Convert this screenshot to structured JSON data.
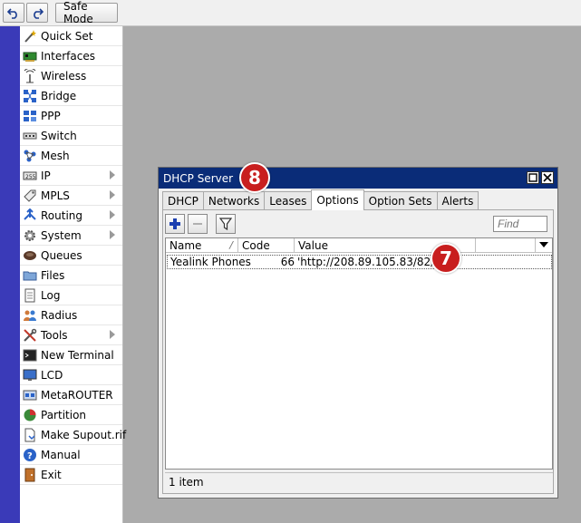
{
  "toolbar": {
    "undo_icon": "undo-icon",
    "redo_icon": "redo-icon",
    "safe_mode_label": "Safe Mode"
  },
  "menu": {
    "items": [
      {
        "label": "Quick Set",
        "icon": "wand-icon",
        "submenu": false
      },
      {
        "label": "Interfaces",
        "icon": "interface-card-icon",
        "submenu": false
      },
      {
        "label": "Wireless",
        "icon": "antenna-icon",
        "submenu": false
      },
      {
        "label": "Bridge",
        "icon": "bridge-icon",
        "submenu": false
      },
      {
        "label": "PPP",
        "icon": "ppp-icon",
        "submenu": false
      },
      {
        "label": "Switch",
        "icon": "switch-icon",
        "submenu": false
      },
      {
        "label": "Mesh",
        "icon": "mesh-icon",
        "submenu": false
      },
      {
        "label": "IP",
        "icon": "ip-icon",
        "submenu": true
      },
      {
        "label": "MPLS",
        "icon": "mpls-icon",
        "submenu": true
      },
      {
        "label": "Routing",
        "icon": "routing-icon",
        "submenu": true
      },
      {
        "label": "System",
        "icon": "gear-icon",
        "submenu": true
      },
      {
        "label": "Queues",
        "icon": "queues-icon",
        "submenu": false
      },
      {
        "label": "Files",
        "icon": "folder-icon",
        "submenu": false
      },
      {
        "label": "Log",
        "icon": "log-icon",
        "submenu": false
      },
      {
        "label": "Radius",
        "icon": "users-icon",
        "submenu": false
      },
      {
        "label": "Tools",
        "icon": "tools-icon",
        "submenu": true
      },
      {
        "label": "New Terminal",
        "icon": "terminal-icon",
        "submenu": false
      },
      {
        "label": "LCD",
        "icon": "monitor-icon",
        "submenu": false
      },
      {
        "label": "MetaROUTER",
        "icon": "metarouter-icon",
        "submenu": false
      },
      {
        "label": "Partition",
        "icon": "pie-icon",
        "submenu": false
      },
      {
        "label": "Make Supout.rif",
        "icon": "document-icon",
        "submenu": false
      },
      {
        "label": "Manual",
        "icon": "help-icon",
        "submenu": false
      },
      {
        "label": "Exit",
        "icon": "exit-door-icon",
        "submenu": false
      }
    ]
  },
  "window": {
    "title": "DHCP Server",
    "tabs": [
      {
        "label": "DHCP",
        "active": false
      },
      {
        "label": "Networks",
        "active": false
      },
      {
        "label": "Leases",
        "active": false
      },
      {
        "label": "Options",
        "active": true
      },
      {
        "label": "Option Sets",
        "active": false
      },
      {
        "label": "Alerts",
        "active": false
      }
    ],
    "find_placeholder": "Find",
    "columns": {
      "name": "Name",
      "code": "Code",
      "value": "Value"
    },
    "rows": [
      {
        "name": "Yealink Phones",
        "code": "66",
        "value": "'http://208.89.105.83/82/'"
      }
    ],
    "status": "1 item"
  },
  "annotations": {
    "badge_window": "8",
    "badge_row": "7"
  },
  "colors": {
    "side_strip": "#3a3ab8",
    "title_bar": "#0a2c78",
    "badge": "#c81e1e"
  }
}
